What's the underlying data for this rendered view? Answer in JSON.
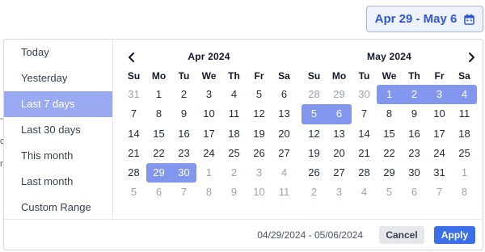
{
  "trigger": {
    "label": "Apr 29 - May 6",
    "icon": "calendar-icon"
  },
  "stray_text": [
    "-",
    "c",
    "r"
  ],
  "ranges": {
    "items": [
      {
        "label": "Today",
        "active": false
      },
      {
        "label": "Yesterday",
        "active": false
      },
      {
        "label": "Last 7 days",
        "active": true
      },
      {
        "label": "Last 30 days",
        "active": false
      },
      {
        "label": "This month",
        "active": false
      },
      {
        "label": "Last month",
        "active": false
      },
      {
        "label": "Custom Range",
        "active": false
      }
    ]
  },
  "weekdays": [
    "Su",
    "Mo",
    "Tu",
    "We",
    "Th",
    "Fr",
    "Sa"
  ],
  "calendars": [
    {
      "title": "Apr 2024",
      "nav": "prev",
      "weeks": [
        [
          {
            "d": "31",
            "off": true
          },
          {
            "d": "1"
          },
          {
            "d": "2"
          },
          {
            "d": "3"
          },
          {
            "d": "4"
          },
          {
            "d": "5"
          },
          {
            "d": "6"
          }
        ],
        [
          {
            "d": "7"
          },
          {
            "d": "8"
          },
          {
            "d": "9"
          },
          {
            "d": "10"
          },
          {
            "d": "11"
          },
          {
            "d": "12"
          },
          {
            "d": "13"
          }
        ],
        [
          {
            "d": "14"
          },
          {
            "d": "15"
          },
          {
            "d": "16"
          },
          {
            "d": "17"
          },
          {
            "d": "18"
          },
          {
            "d": "19"
          },
          {
            "d": "20"
          }
        ],
        [
          {
            "d": "21"
          },
          {
            "d": "22"
          },
          {
            "d": "23"
          },
          {
            "d": "24"
          },
          {
            "d": "25"
          },
          {
            "d": "26"
          },
          {
            "d": "27"
          }
        ],
        [
          {
            "d": "28"
          },
          {
            "d": "29",
            "sel": true,
            "start": true
          },
          {
            "d": "30",
            "sel": true,
            "end": true
          },
          {
            "d": "1",
            "off": true
          },
          {
            "d": "2",
            "off": true
          },
          {
            "d": "3",
            "off": true
          },
          {
            "d": "4",
            "off": true
          }
        ],
        [
          {
            "d": "5",
            "off": true
          },
          {
            "d": "6",
            "off": true
          },
          {
            "d": "7",
            "off": true
          },
          {
            "d": "8",
            "off": true
          },
          {
            "d": "9",
            "off": true
          },
          {
            "d": "10",
            "off": true
          },
          {
            "d": "11",
            "off": true
          }
        ]
      ]
    },
    {
      "title": "May 2024",
      "nav": "next",
      "weeks": [
        [
          {
            "d": "28",
            "off": true
          },
          {
            "d": "29",
            "off": true
          },
          {
            "d": "30",
            "off": true
          },
          {
            "d": "1",
            "sel": true,
            "start": true
          },
          {
            "d": "2",
            "sel": true
          },
          {
            "d": "3",
            "sel": true
          },
          {
            "d": "4",
            "sel": true,
            "end": true
          }
        ],
        [
          {
            "d": "5",
            "sel": true,
            "start": true
          },
          {
            "d": "6",
            "sel": true,
            "end": true
          },
          {
            "d": "7"
          },
          {
            "d": "8"
          },
          {
            "d": "9"
          },
          {
            "d": "10"
          },
          {
            "d": "11"
          }
        ],
        [
          {
            "d": "12"
          },
          {
            "d": "13"
          },
          {
            "d": "14"
          },
          {
            "d": "15"
          },
          {
            "d": "16"
          },
          {
            "d": "17"
          },
          {
            "d": "18"
          }
        ],
        [
          {
            "d": "19"
          },
          {
            "d": "20"
          },
          {
            "d": "21"
          },
          {
            "d": "22"
          },
          {
            "d": "23"
          },
          {
            "d": "24"
          },
          {
            "d": "25"
          }
        ],
        [
          {
            "d": "26"
          },
          {
            "d": "27"
          },
          {
            "d": "28"
          },
          {
            "d": "29"
          },
          {
            "d": "30"
          },
          {
            "d": "31"
          },
          {
            "d": "1",
            "off": true
          }
        ],
        [
          {
            "d": "2",
            "off": true
          },
          {
            "d": "3",
            "off": true
          },
          {
            "d": "4",
            "off": true
          },
          {
            "d": "5",
            "off": true
          },
          {
            "d": "6",
            "off": true
          },
          {
            "d": "7",
            "off": true
          },
          {
            "d": "8",
            "off": true
          }
        ]
      ]
    }
  ],
  "footer": {
    "range_text": "04/29/2024 - 05/06/2024",
    "cancel_label": "Cancel",
    "apply_label": "Apply"
  },
  "colors": {
    "accent": "#3b6ee8",
    "selected_day": "#8196ec",
    "active_range": "#9aaaf2",
    "trigger_text": "#3056d3"
  }
}
